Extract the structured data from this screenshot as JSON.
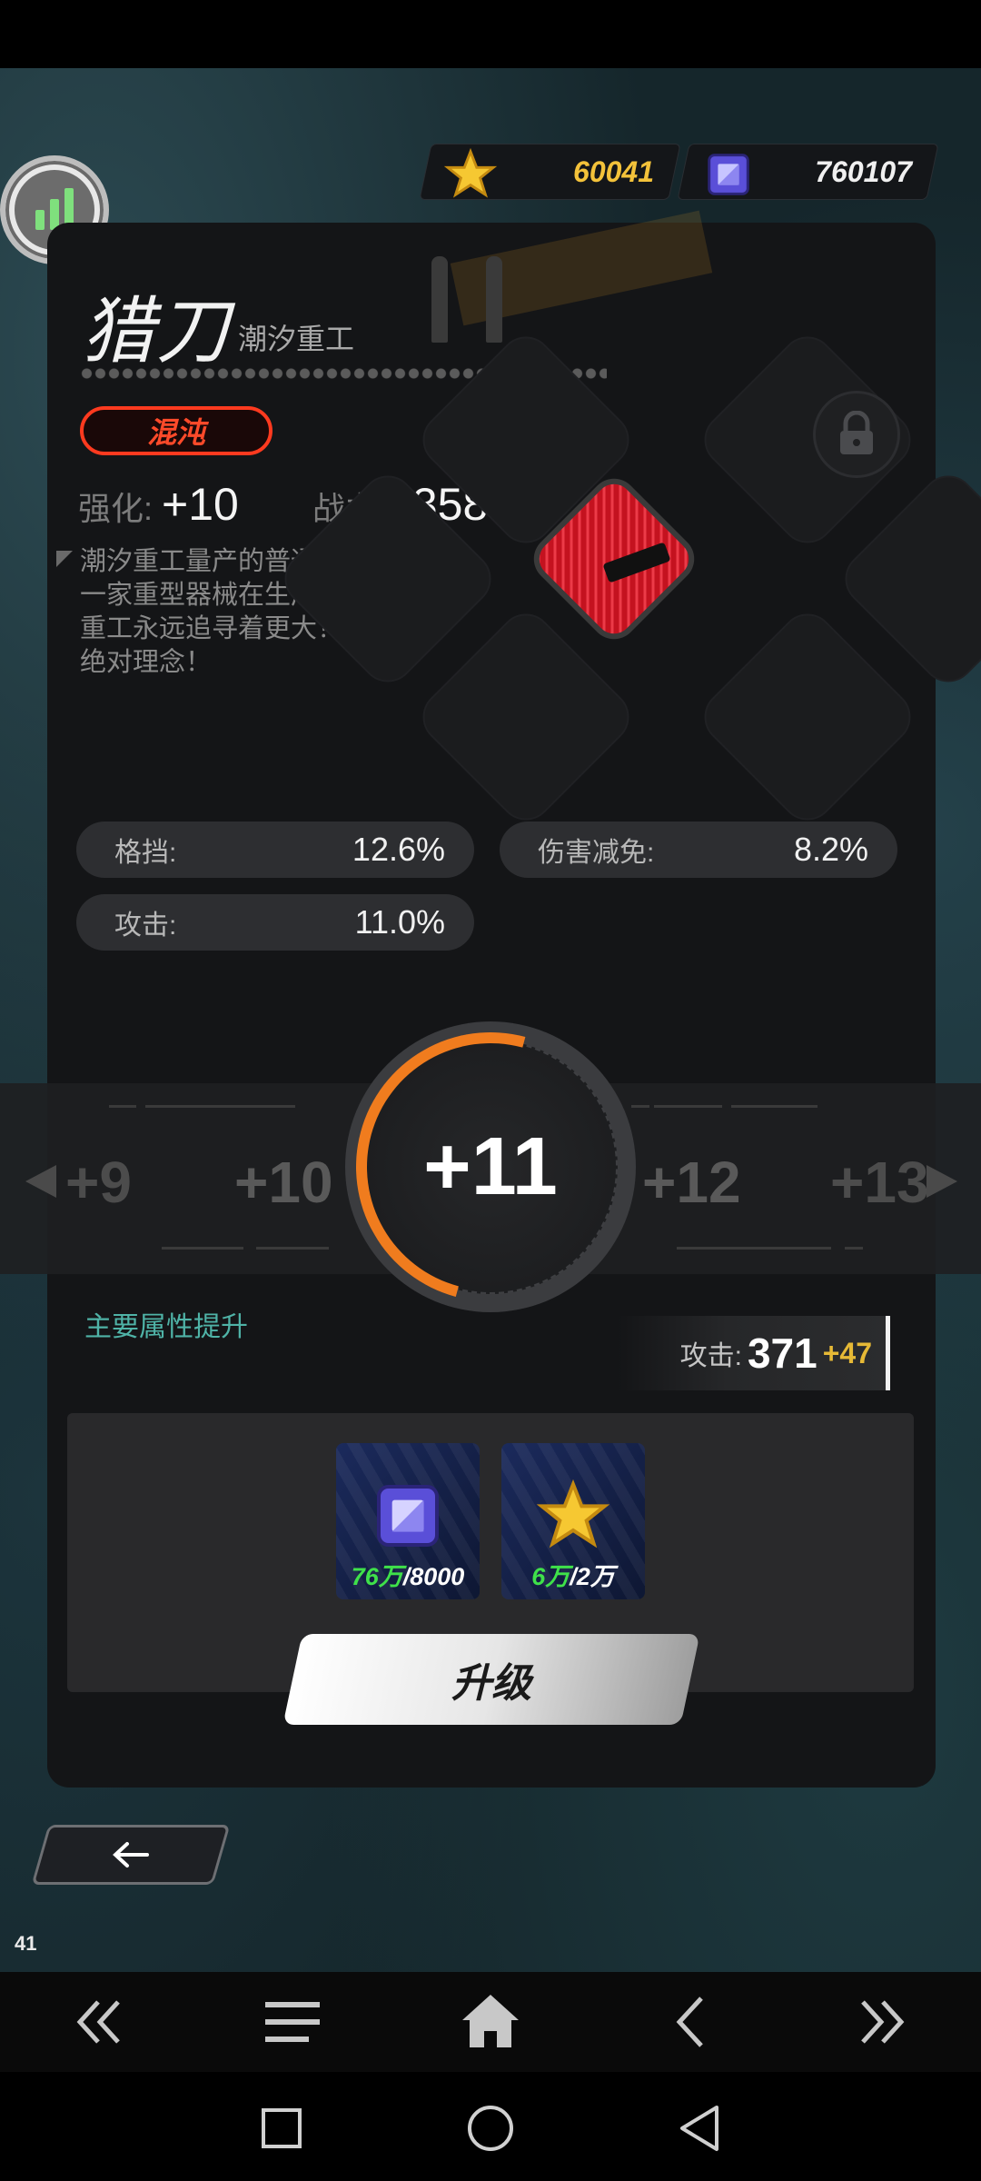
{
  "currency": {
    "gold": "60041",
    "gem": "760107"
  },
  "item": {
    "name": "猎刀",
    "maker": "潮汐重工",
    "rarity": "混沌",
    "enhance_label": "强化:",
    "enhance_value": "+10",
    "power_label": "战力",
    "power_value": "2358",
    "description": "潮汐重工量产的普通芯片作为一家重型器械在生产商，潮汐重工永远追寻着更大！更强的绝对理念！"
  },
  "attributes": [
    {
      "label": "格挡:",
      "value": "12.6%"
    },
    {
      "label": "伤害减免:",
      "value": "8.2%"
    },
    {
      "label": "攻击:",
      "value": "11.0%"
    }
  ],
  "levels": {
    "prev2": "+9",
    "prev1": "+10",
    "current": "+11",
    "next1": "+12",
    "next2": "+13",
    "progress_fraction": 0.55
  },
  "upgrade": {
    "section_label": "主要属性提升",
    "attr_label": "攻击:",
    "attr_value": "371",
    "attr_plus": "+47",
    "costs": [
      {
        "icon": "gem-icon",
        "have": "76万",
        "need": "/8000"
      },
      {
        "icon": "gold-star-icon",
        "have": "6万",
        "need": "/2万"
      }
    ],
    "button_label": "升级"
  },
  "fps": "41",
  "colors": {
    "accent_orange": "#f07c1e",
    "gold": "#f3c23a",
    "rarity_red": "#ff3a1f",
    "teal_label": "#4fb3a7",
    "green_have": "#3fe14a"
  }
}
